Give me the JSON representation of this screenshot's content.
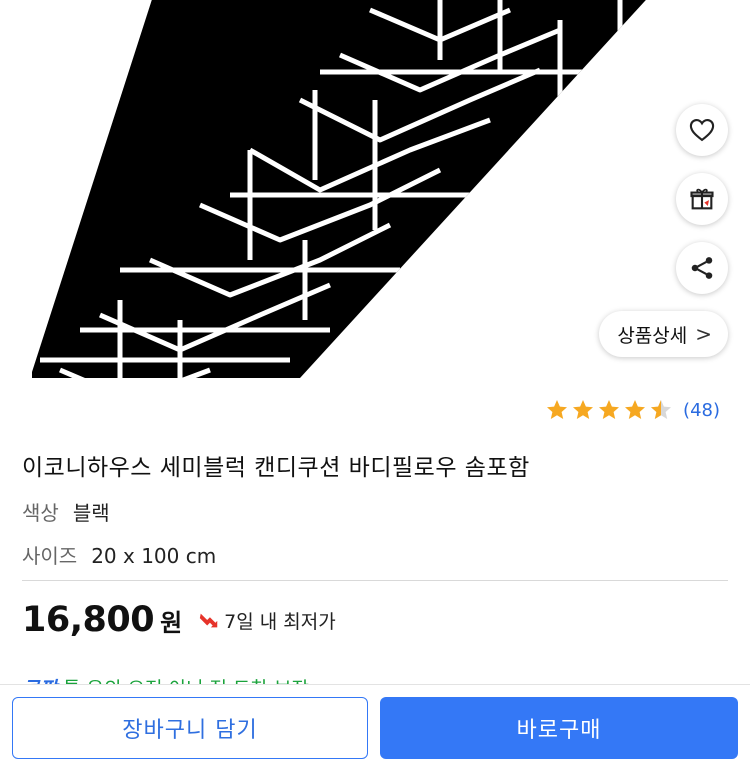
{
  "hero": {
    "image": "black-braided-body-pillow",
    "colors": {
      "pillow": "#000000",
      "lines": "#ffffff"
    }
  },
  "actions": {
    "wish_icon": "heart-icon",
    "gift_icon": "gift-icon",
    "share_icon": "share-icon",
    "detail_label": "상품상세",
    "detail_chevron": ">"
  },
  "rating": {
    "stars": 4.5,
    "review_count": "(48)"
  },
  "product": {
    "title": "이코니하우스 세미블럭 캔디쿠션 바디필로우 솜포함",
    "options": {
      "color_label": "색상",
      "color_value": "블랙",
      "size_label": "사이즈",
      "size_value": "20 x 100 cm"
    }
  },
  "price": {
    "amount": "16,800",
    "currency": "원",
    "badge_text": "7일 내 최저가"
  },
  "promo": {
    "brand": "쿠팡",
    "text": "특 유의 오전 이니 적 도착 보장"
  },
  "bottom": {
    "cart_label": "장바구니 담기",
    "buy_label": "바로구매"
  },
  "theme": {
    "accent": "#3478f6",
    "star": "#f6a821",
    "link": "#2a6be0"
  }
}
